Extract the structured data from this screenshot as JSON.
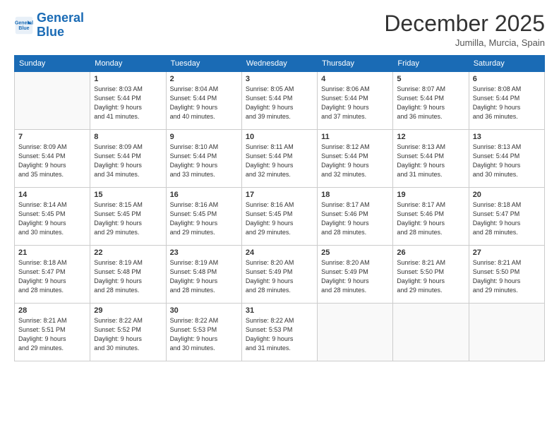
{
  "logo": {
    "line1": "General",
    "line2": "Blue"
  },
  "title": "December 2025",
  "location": "Jumilla, Murcia, Spain",
  "weekdays": [
    "Sunday",
    "Monday",
    "Tuesday",
    "Wednesday",
    "Thursday",
    "Friday",
    "Saturday"
  ],
  "weeks": [
    [
      {
        "day": "",
        "info": ""
      },
      {
        "day": "1",
        "info": "Sunrise: 8:03 AM\nSunset: 5:44 PM\nDaylight: 9 hours\nand 41 minutes."
      },
      {
        "day": "2",
        "info": "Sunrise: 8:04 AM\nSunset: 5:44 PM\nDaylight: 9 hours\nand 40 minutes."
      },
      {
        "day": "3",
        "info": "Sunrise: 8:05 AM\nSunset: 5:44 PM\nDaylight: 9 hours\nand 39 minutes."
      },
      {
        "day": "4",
        "info": "Sunrise: 8:06 AM\nSunset: 5:44 PM\nDaylight: 9 hours\nand 37 minutes."
      },
      {
        "day": "5",
        "info": "Sunrise: 8:07 AM\nSunset: 5:44 PM\nDaylight: 9 hours\nand 36 minutes."
      },
      {
        "day": "6",
        "info": "Sunrise: 8:08 AM\nSunset: 5:44 PM\nDaylight: 9 hours\nand 36 minutes."
      }
    ],
    [
      {
        "day": "7",
        "info": "Sunrise: 8:09 AM\nSunset: 5:44 PM\nDaylight: 9 hours\nand 35 minutes."
      },
      {
        "day": "8",
        "info": "Sunrise: 8:09 AM\nSunset: 5:44 PM\nDaylight: 9 hours\nand 34 minutes."
      },
      {
        "day": "9",
        "info": "Sunrise: 8:10 AM\nSunset: 5:44 PM\nDaylight: 9 hours\nand 33 minutes."
      },
      {
        "day": "10",
        "info": "Sunrise: 8:11 AM\nSunset: 5:44 PM\nDaylight: 9 hours\nand 32 minutes."
      },
      {
        "day": "11",
        "info": "Sunrise: 8:12 AM\nSunset: 5:44 PM\nDaylight: 9 hours\nand 32 minutes."
      },
      {
        "day": "12",
        "info": "Sunrise: 8:13 AM\nSunset: 5:44 PM\nDaylight: 9 hours\nand 31 minutes."
      },
      {
        "day": "13",
        "info": "Sunrise: 8:13 AM\nSunset: 5:44 PM\nDaylight: 9 hours\nand 30 minutes."
      }
    ],
    [
      {
        "day": "14",
        "info": "Sunrise: 8:14 AM\nSunset: 5:45 PM\nDaylight: 9 hours\nand 30 minutes."
      },
      {
        "day": "15",
        "info": "Sunrise: 8:15 AM\nSunset: 5:45 PM\nDaylight: 9 hours\nand 29 minutes."
      },
      {
        "day": "16",
        "info": "Sunrise: 8:16 AM\nSunset: 5:45 PM\nDaylight: 9 hours\nand 29 minutes."
      },
      {
        "day": "17",
        "info": "Sunrise: 8:16 AM\nSunset: 5:45 PM\nDaylight: 9 hours\nand 29 minutes."
      },
      {
        "day": "18",
        "info": "Sunrise: 8:17 AM\nSunset: 5:46 PM\nDaylight: 9 hours\nand 28 minutes."
      },
      {
        "day": "19",
        "info": "Sunrise: 8:17 AM\nSunset: 5:46 PM\nDaylight: 9 hours\nand 28 minutes."
      },
      {
        "day": "20",
        "info": "Sunrise: 8:18 AM\nSunset: 5:47 PM\nDaylight: 9 hours\nand 28 minutes."
      }
    ],
    [
      {
        "day": "21",
        "info": "Sunrise: 8:18 AM\nSunset: 5:47 PM\nDaylight: 9 hours\nand 28 minutes."
      },
      {
        "day": "22",
        "info": "Sunrise: 8:19 AM\nSunset: 5:48 PM\nDaylight: 9 hours\nand 28 minutes."
      },
      {
        "day": "23",
        "info": "Sunrise: 8:19 AM\nSunset: 5:48 PM\nDaylight: 9 hours\nand 28 minutes."
      },
      {
        "day": "24",
        "info": "Sunrise: 8:20 AM\nSunset: 5:49 PM\nDaylight: 9 hours\nand 28 minutes."
      },
      {
        "day": "25",
        "info": "Sunrise: 8:20 AM\nSunset: 5:49 PM\nDaylight: 9 hours\nand 28 minutes."
      },
      {
        "day": "26",
        "info": "Sunrise: 8:21 AM\nSunset: 5:50 PM\nDaylight: 9 hours\nand 29 minutes."
      },
      {
        "day": "27",
        "info": "Sunrise: 8:21 AM\nSunset: 5:50 PM\nDaylight: 9 hours\nand 29 minutes."
      }
    ],
    [
      {
        "day": "28",
        "info": "Sunrise: 8:21 AM\nSunset: 5:51 PM\nDaylight: 9 hours\nand 29 minutes."
      },
      {
        "day": "29",
        "info": "Sunrise: 8:22 AM\nSunset: 5:52 PM\nDaylight: 9 hours\nand 30 minutes."
      },
      {
        "day": "30",
        "info": "Sunrise: 8:22 AM\nSunset: 5:53 PM\nDaylight: 9 hours\nand 30 minutes."
      },
      {
        "day": "31",
        "info": "Sunrise: 8:22 AM\nSunset: 5:53 PM\nDaylight: 9 hours\nand 31 minutes."
      },
      {
        "day": "",
        "info": ""
      },
      {
        "day": "",
        "info": ""
      },
      {
        "day": "",
        "info": ""
      }
    ]
  ]
}
